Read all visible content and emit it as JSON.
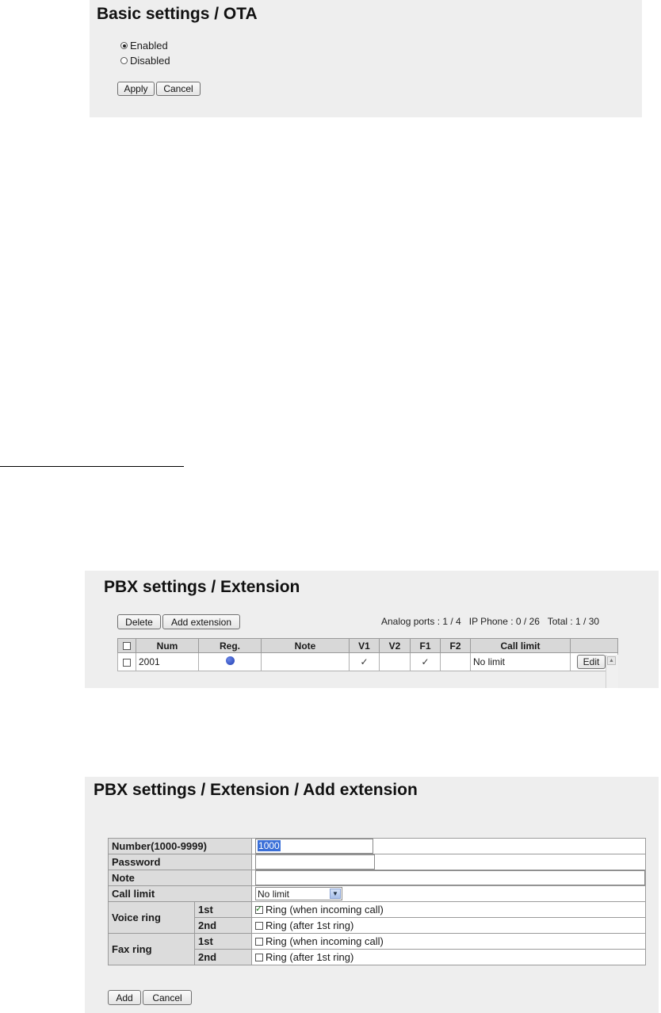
{
  "ota": {
    "title": "Basic settings / OTA",
    "options": [
      {
        "label": "Enabled",
        "checked": true
      },
      {
        "label": "Disabled",
        "checked": false
      }
    ],
    "apply_label": "Apply",
    "cancel_label": "Cancel"
  },
  "extension": {
    "title": "PBX settings / Extension",
    "delete_label": "Delete",
    "add_label": "Add extension",
    "stats": "Analog ports : 1 / 4   IP Phone : 0 / 26   Total : 1 / 30",
    "columns": [
      "Num",
      "Reg.",
      "Note",
      "V1",
      "V2",
      "F1",
      "F2",
      "Call limit"
    ],
    "rows": [
      {
        "num": "2001",
        "registered": true,
        "note": "",
        "v1": "✓",
        "v2": "",
        "f1": "✓",
        "f2": "",
        "call_limit": "No limit",
        "edit_label": "Edit"
      }
    ]
  },
  "add_extension": {
    "title": "PBX settings / Extension / Add extension",
    "number_label": "Number(1000-9999)",
    "number_value": "1000",
    "password_label": "Password",
    "password_value": "",
    "note_label": "Note",
    "note_value": "",
    "call_limit_label": "Call limit",
    "call_limit_value": "No limit",
    "voice_ring_label": "Voice ring",
    "fax_ring_label": "Fax ring",
    "first_label": "1st",
    "second_label": "2nd",
    "ring_incoming_label": "Ring (when incoming call)",
    "ring_after_label": "Ring (after 1st ring)",
    "voice_first_checked": true,
    "voice_second_checked": false,
    "fax_first_checked": false,
    "fax_second_checked": false,
    "add_label": "Add",
    "cancel_label": "Cancel"
  },
  "colors": {
    "panel_bg": "#eeeeee",
    "header_bg": "#d8d8d8",
    "selection": "#3a6fd8",
    "reg_dot": "#1f3db0"
  }
}
